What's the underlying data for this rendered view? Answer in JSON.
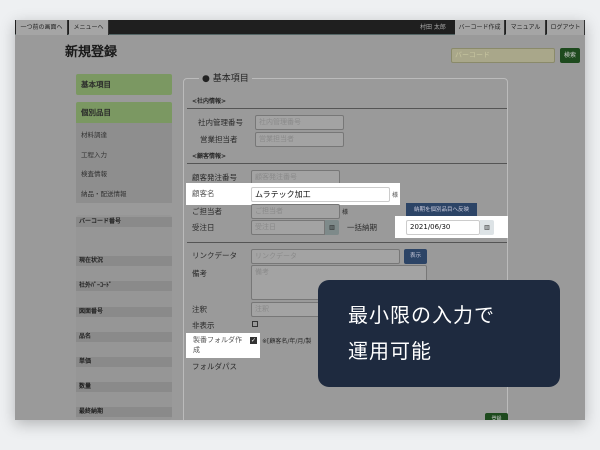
{
  "topbar": {
    "back": "一つ前の画面へ",
    "menu": "メニューへ",
    "user": "村田 太郎",
    "barcode_create": "バーコード作成",
    "manual": "マニュアル",
    "logout": "ログアウト"
  },
  "header": {
    "title": "新規登録",
    "barcode_placeholder": "バーコード",
    "search": "検索"
  },
  "sidebar": {
    "tabs": [
      "基本項目",
      "個別品目"
    ],
    "items": [
      "材料調達",
      "工程入力",
      "検査情報",
      "納品・配送情報"
    ],
    "panel": [
      "バーコード番号",
      "現在状況",
      "社外ﾊﾞｰｺｰﾄﾞ",
      "図面番号",
      "品名",
      "単価",
      "数量",
      "最終納期"
    ]
  },
  "form": {
    "legend": "基本項目",
    "section_internal": "<社内情報>",
    "section_customer": "<顧客情報>",
    "internal_no_label": "社内管理番号",
    "internal_no_ph": "社内管理番号",
    "sales_label": "営業担当者",
    "sales_ph": "営業担当者",
    "order_no_label": "顧客発注番号",
    "order_no_ph": "顧客発注番号",
    "customer_label": "顧客名",
    "customer_value": "ムラテック加工",
    "honorific": "様",
    "contact_label": "ご担当者",
    "contact_ph": "ご担当者",
    "reflect_button": "納期を個別品目へ反映",
    "order_date_label": "受注日",
    "order_date_ph": "受注日",
    "bulk_due_label": "一括納期",
    "bulk_due_value": "2021/06/30",
    "link_label": "リンクデータ",
    "link_ph": "リンクデータ",
    "show_button": "表示",
    "remarks_label": "備考",
    "remarks_ph": "備考",
    "note_label": "注釈",
    "note_ph": "注釈",
    "hidden_label": "非表示",
    "folder_label": "製番フォルダ作成",
    "folder_hint": "※[顧客名/年/月/製",
    "folder_path_label": "フォルダパス",
    "save_button": "登録"
  },
  "overlay": {
    "line1": "最小限の入力で",
    "line2": "運用可能"
  }
}
